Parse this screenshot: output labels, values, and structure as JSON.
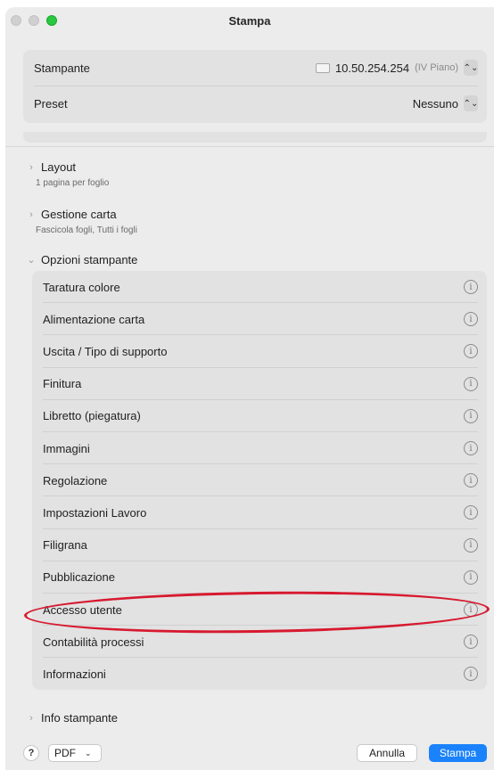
{
  "window": {
    "title": "Stampa"
  },
  "printer": {
    "label": "Stampante",
    "name": "10.50.254.254",
    "floor": "(IV Piano)"
  },
  "preset": {
    "label": "Preset",
    "value": "Nessuno"
  },
  "sections": {
    "layout": {
      "label": "Layout",
      "sub": "1 pagina per foglio",
      "chevron": "›"
    },
    "paper": {
      "label": "Gestione carta",
      "sub": "Fascicola fogli, Tutti i fogli",
      "chevron": "›"
    },
    "printer_options": {
      "label": "Opzioni stampante",
      "chevron": "⌄"
    },
    "printer_info": {
      "label": "Info stampante",
      "chevron": "›"
    }
  },
  "options": [
    {
      "label": "Taratura colore"
    },
    {
      "label": "Alimentazione carta"
    },
    {
      "label": "Uscita / Tipo di supporto"
    },
    {
      "label": "Finitura"
    },
    {
      "label": "Libretto (piegatura)"
    },
    {
      "label": "Immagini"
    },
    {
      "label": "Regolazione"
    },
    {
      "label": "Impostazioni Lavoro"
    },
    {
      "label": "Filigrana"
    },
    {
      "label": "Pubblicazione"
    },
    {
      "label": "Accesso utente"
    },
    {
      "label": "Contabilità processi"
    },
    {
      "label": "Informazioni"
    }
  ],
  "icons": {
    "info": "i",
    "help": "?",
    "stepper": "⌃⌄",
    "dropdown": "⌄"
  },
  "footer": {
    "help": "?",
    "pdf": "PDF",
    "cancel": "Annulla",
    "print": "Stampa"
  },
  "colors": {
    "accent": "#1a82fb",
    "annotation": "#d7192f",
    "traffic_green": "#28c840"
  }
}
